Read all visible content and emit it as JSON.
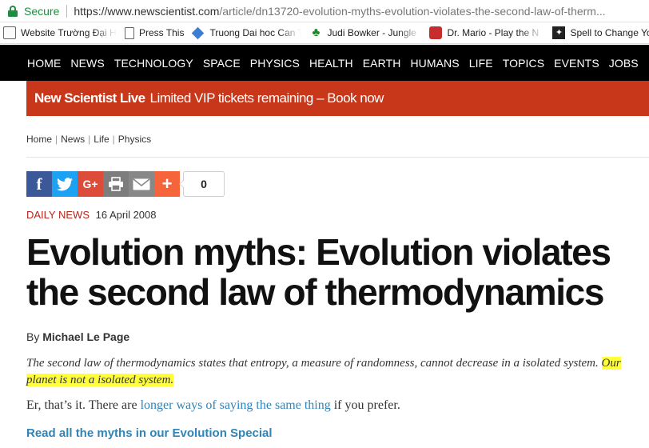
{
  "browser": {
    "secure_label": "Secure",
    "url_base": "https://www.newscientist.com",
    "url_path": "/article/dn13720-evolution-myths-evolution-violates-the-second-law-of-therm..."
  },
  "bookmarks": [
    {
      "label": "Website Trường Đại H",
      "icon": "folder-icon"
    },
    {
      "label": "Press This",
      "icon": "page-icon"
    },
    {
      "label": "Truong Dai hoc Can T",
      "icon": "diamond-icon"
    },
    {
      "label": "Judi Bowker - Jungle",
      "icon": "clover-icon"
    },
    {
      "label": "Dr. Mario - Play the N",
      "icon": "mario-icon"
    },
    {
      "label": "Spell to Change Your",
      "icon": "spell-icon"
    }
  ],
  "nav": [
    "HOME",
    "NEWS",
    "TECHNOLOGY",
    "SPACE",
    "PHYSICS",
    "HEALTH",
    "EARTH",
    "HUMANS",
    "LIFE",
    "TOPICS",
    "EVENTS",
    "JOBS"
  ],
  "promo": {
    "brand": "New Scientist Live",
    "message": "Limited VIP tickets remaining – Book now",
    "color": "#c9371a"
  },
  "breadcrumb": [
    "Home",
    "News",
    "Life",
    "Physics"
  ],
  "share": {
    "buttons": [
      "facebook-icon",
      "twitter-icon",
      "google-plus-icon",
      "print-icon",
      "email-icon",
      "plus-icon"
    ],
    "count": "0"
  },
  "article": {
    "kind": "DAILY NEWS",
    "date": "16 April 2008",
    "title": "Evolution myths: Evolution violates the second law of thermodynamics",
    "by_prefix": "By",
    "author": "Michael Le Page",
    "standfirst_1": "The second law of thermodynamics states that entropy, a measure of randomness, cannot decrease in a isolated system.",
    "standfirst_highlight": "Our planet is not a isolated system.",
    "para_before": "Er, that’s it. There are",
    "para_link": "longer ways of saying the same thing",
    "para_after": "if you prefer.",
    "special_link": "Read all the myths in our Evolution Special"
  }
}
